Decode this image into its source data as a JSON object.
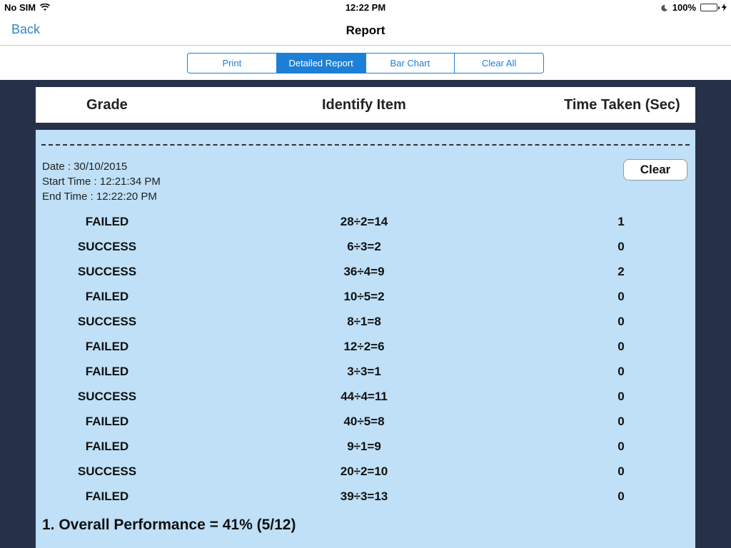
{
  "status": {
    "carrier": "No SIM",
    "time": "12:22 PM",
    "battery": "100%"
  },
  "nav": {
    "back_label": "Back",
    "title": "Report"
  },
  "tabs": [
    {
      "label": "Print",
      "active": false
    },
    {
      "label": "Detailed Report",
      "active": true
    },
    {
      "label": "Bar Chart",
      "active": false
    },
    {
      "label": "Clear All",
      "active": false
    }
  ],
  "table": {
    "headers": [
      "Grade",
      "Identify Item",
      "Time Taken (Sec)"
    ]
  },
  "session": {
    "date": "Date : 30/10/2015",
    "start_time": "Start Time : 12:21:34 PM",
    "end_time": "End Time : 12:22:20 PM",
    "clear_label": "Clear",
    "rows": [
      {
        "grade": "FAILED",
        "item": "28÷2=14",
        "time": "1"
      },
      {
        "grade": "SUCCESS",
        "item": "6÷3=2",
        "time": "0"
      },
      {
        "grade": "SUCCESS",
        "item": "36÷4=9",
        "time": "2"
      },
      {
        "grade": "FAILED",
        "item": "10÷5=2",
        "time": "0"
      },
      {
        "grade": "SUCCESS",
        "item": "8÷1=8",
        "time": "0"
      },
      {
        "grade": "FAILED",
        "item": "12÷2=6",
        "time": "0"
      },
      {
        "grade": "FAILED",
        "item": "3÷3=1",
        "time": "0"
      },
      {
        "grade": "SUCCESS",
        "item": "44÷4=11",
        "time": "0"
      },
      {
        "grade": "FAILED",
        "item": "40÷5=8",
        "time": "0"
      },
      {
        "grade": "FAILED",
        "item": "9÷1=9",
        "time": "0"
      },
      {
        "grade": "SUCCESS",
        "item": "20÷2=10",
        "time": "0"
      },
      {
        "grade": "FAILED",
        "item": "39÷3=13",
        "time": "0"
      }
    ],
    "overall": "1. Overall Performance = 41% (5/12)"
  },
  "colors": {
    "accent": "#1d7fd6",
    "content_bg": "#bfe0f7",
    "page_bg": "#263149"
  }
}
